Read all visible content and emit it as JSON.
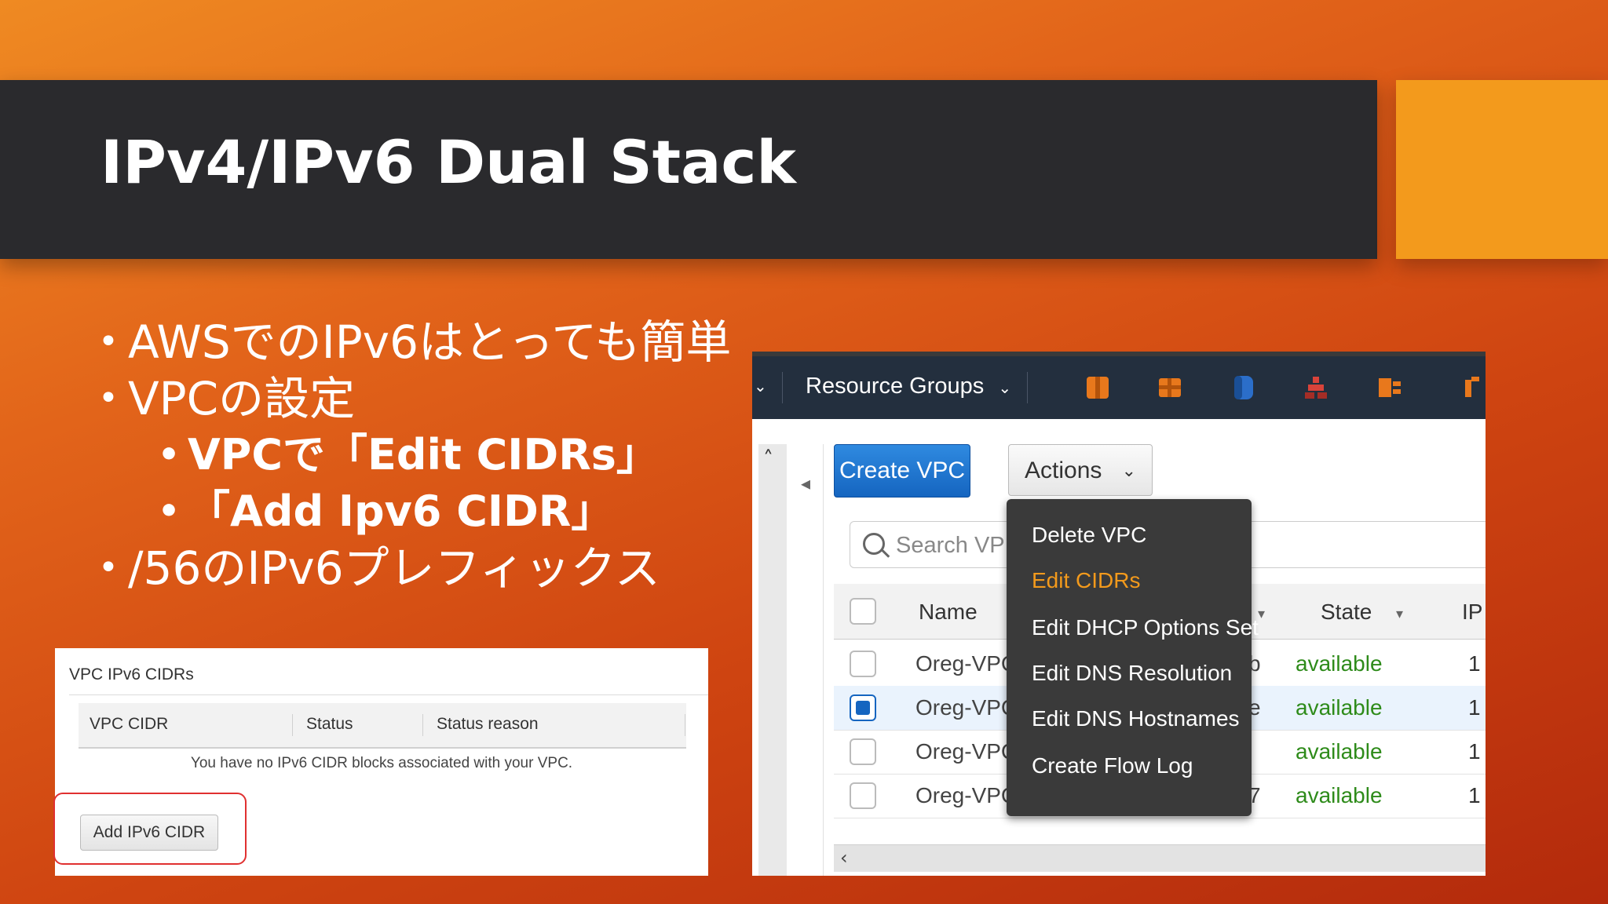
{
  "slide": {
    "title": "IPv4/IPv6 Dual Stack",
    "bullets": [
      {
        "text": "AWSでのIPv6はとっても簡単",
        "level": 1
      },
      {
        "text": "VPCの設定",
        "level": 1
      },
      {
        "text": "VPCで「Edit CIDRs」",
        "level": 2
      },
      {
        "text": "「Add Ipv6 CIDR」",
        "level": 2
      },
      {
        "text": "/56のIPv6プレフィックス",
        "level": 1
      }
    ],
    "colors": {
      "title_bar": "#2a2a2d",
      "accent": "#f39a1c",
      "background_from": "#ef8a22",
      "background_to": "#b32a0c"
    }
  },
  "ipv6_panel": {
    "header": "VPC IPv6 CIDRs",
    "columns": [
      "VPC CIDR",
      "Status",
      "Status reason"
    ],
    "empty_message": "You have no IPv6 CIDR blocks associated with your VPC.",
    "add_button": "Add IPv6 CIDR"
  },
  "console": {
    "nav": {
      "resource_groups": "Resource Groups",
      "icons": [
        "ec2-service-icon",
        "s3-service-icon",
        "dynamodb-service-icon",
        "codedeploy-service-icon",
        "cloudfront-service-icon",
        "lambda-service-icon"
      ]
    },
    "create_button": "Create VPC",
    "actions_button": "Actions",
    "search_placeholder": "Search VP",
    "columns": {
      "name": "Name",
      "state": "State",
      "ip": "IP"
    },
    "rows": [
      {
        "name": "Oreg-VPC",
        "frag": "b",
        "state": "available",
        "ip": "1",
        "checked": false
      },
      {
        "name": "Oreg-VPC",
        "frag": "e",
        "state": "available",
        "ip": "1",
        "checked": true
      },
      {
        "name": "Oreg-VPC",
        "frag": "",
        "state": "available",
        "ip": "1",
        "checked": false
      },
      {
        "name": "Oreg-VPC",
        "frag": "7",
        "state": "available",
        "ip": "1",
        "checked": false
      }
    ],
    "actions_menu": [
      {
        "label": "Delete VPC",
        "active": false
      },
      {
        "label": "Edit CIDRs",
        "active": true
      },
      {
        "label": "Edit DHCP Options Set",
        "active": false
      },
      {
        "label": "Edit DNS Resolution",
        "active": false
      },
      {
        "label": "Edit DNS Hostnames",
        "active": false
      },
      {
        "label": "Create Flow Log",
        "active": false
      }
    ]
  }
}
